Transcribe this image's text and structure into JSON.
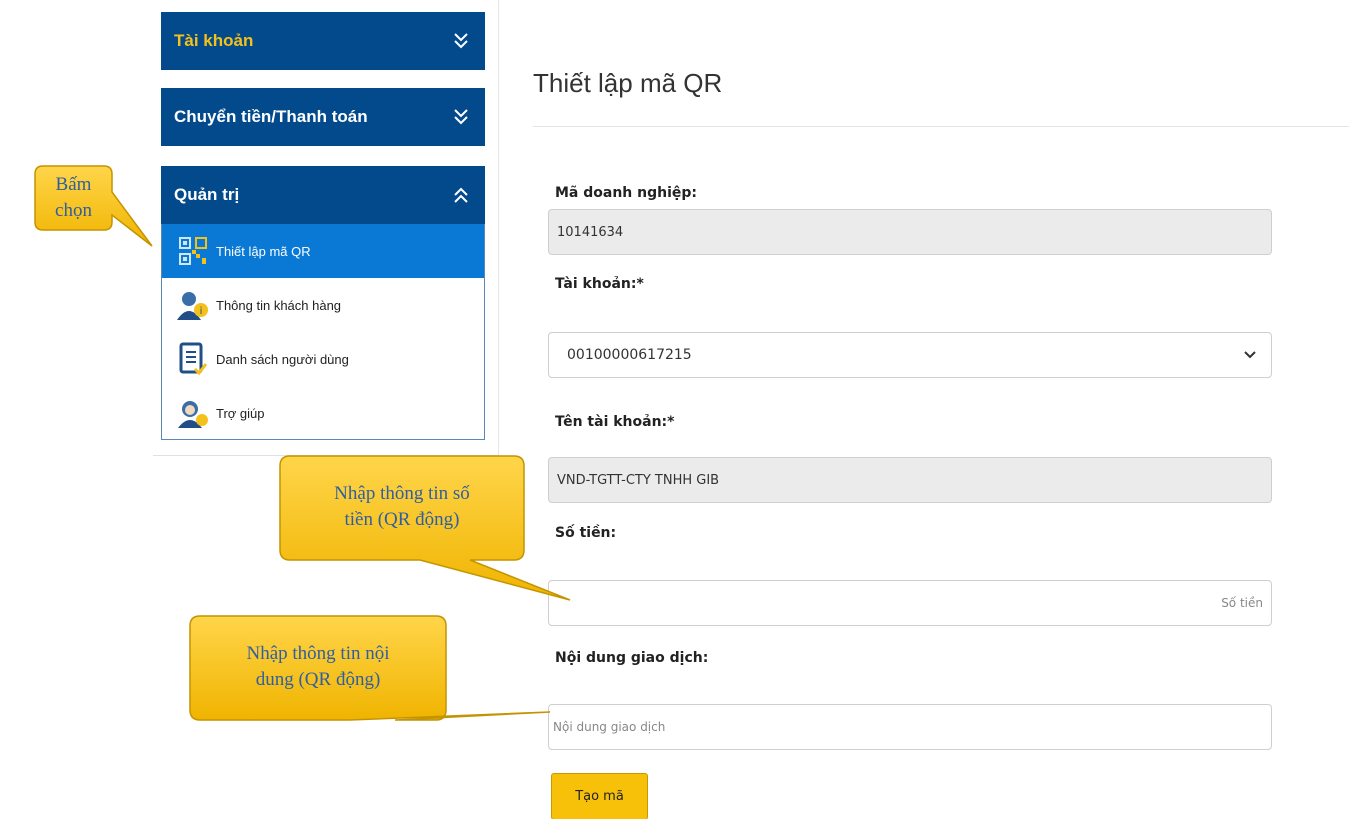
{
  "sidebar": {
    "menus": [
      {
        "label": "Tài khoản",
        "state": "collapsed"
      },
      {
        "label": "Chuyển tiền/Thanh toán",
        "state": "collapsed"
      },
      {
        "label": "Quản trị",
        "state": "expanded"
      }
    ],
    "items": [
      {
        "label": "Thiết lập mã QR",
        "icon": "qr-code-icon",
        "active": true
      },
      {
        "label": "Thông tin khách hàng",
        "icon": "customer-info-icon",
        "active": false
      },
      {
        "label": "Danh sách người dùng",
        "icon": "user-list-icon",
        "active": false
      },
      {
        "label": "Trợ giúp",
        "icon": "support-icon",
        "active": false
      }
    ]
  },
  "main": {
    "title": "Thiết lập mã QR",
    "form": {
      "business_code": {
        "label": "Mã doanh nghiệp:",
        "value": "10141634"
      },
      "account": {
        "label": "Tài khoản:*",
        "value": "00100000617215"
      },
      "account_name": {
        "label": "Tên tài khoản:*",
        "value": "VND-TGTT-CTY TNHH GIB"
      },
      "amount": {
        "label": "Số tiền:",
        "value": "",
        "placeholder": "Số tiền"
      },
      "content": {
        "label": "Nội dung giao dịch:",
        "value": "",
        "placeholder": "Nội dung giao dịch"
      },
      "submit_label": "Tạo mã"
    }
  },
  "callouts": {
    "select": {
      "line1": "Bấm",
      "line2": "chọn"
    },
    "amount": {
      "line1": "Nhập thông tin số",
      "line2": "tiền (QR động)"
    },
    "content": {
      "line1": "Nhập thông tin nội",
      "line2": "dung (QR động)"
    }
  },
  "colors": {
    "menu_header": "#034a8c",
    "menu_accent_text": "#f3c11a",
    "active_item": "#0a79d6",
    "button": "#f7c10a",
    "callout_fill": "#ffc000",
    "callout_text": "#2f5fa0"
  }
}
